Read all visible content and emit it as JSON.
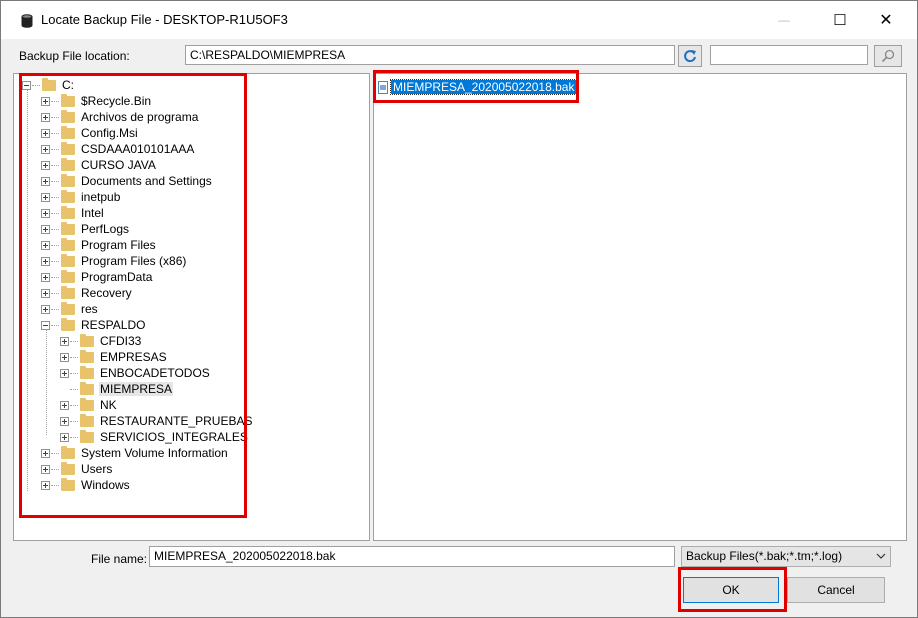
{
  "window": {
    "title": "Locate Backup File - DESKTOP-R1U5OF3",
    "minimize_label": "—",
    "maximize_label": "☐",
    "close_label": "✕"
  },
  "location": {
    "label": "Backup File location:",
    "path": "C:\\RESPALDO\\MIEMPRESA",
    "search_value": ""
  },
  "tree": {
    "root": "C:",
    "items": [
      "$Recycle.Bin",
      "Archivos de programa",
      "Config.Msi",
      "CSDAAA010101AAA",
      "CURSO JAVA",
      "Documents and Settings",
      "inetpub",
      "Intel",
      "PerfLogs",
      "Program Files",
      "Program Files (x86)",
      "ProgramData",
      "Recovery",
      "res",
      "RESPALDO",
      "System Volume Information",
      "Users",
      "Windows"
    ],
    "respaldo_children": [
      "CFDI33",
      "EMPRESAS",
      "ENBOCADETODOS",
      "MIEMPRESA",
      "NK",
      "RESTAURANTE_PRUEBAS",
      "SERVICIOS_INTEGRALES"
    ],
    "selected": "MIEMPRESA"
  },
  "files": {
    "items": [
      "MIEMPRESA_202005022018.bak"
    ]
  },
  "footer": {
    "file_name_label": "File name:",
    "file_name_value": "MIEMPRESA_202005022018.bak",
    "file_type": "Backup Files(*.bak;*.tm;*.log)",
    "ok_label": "OK",
    "cancel_label": "Cancel"
  },
  "colors": {
    "highlight": "#e00000",
    "selection": "#0078d7",
    "folder": "#e8c36b"
  },
  "icons": {
    "app": "database-icon",
    "refresh": "refresh-icon",
    "search": "search-icon",
    "folder": "folder-icon",
    "file": "file-icon",
    "dropdown": "chevron-down-icon"
  }
}
